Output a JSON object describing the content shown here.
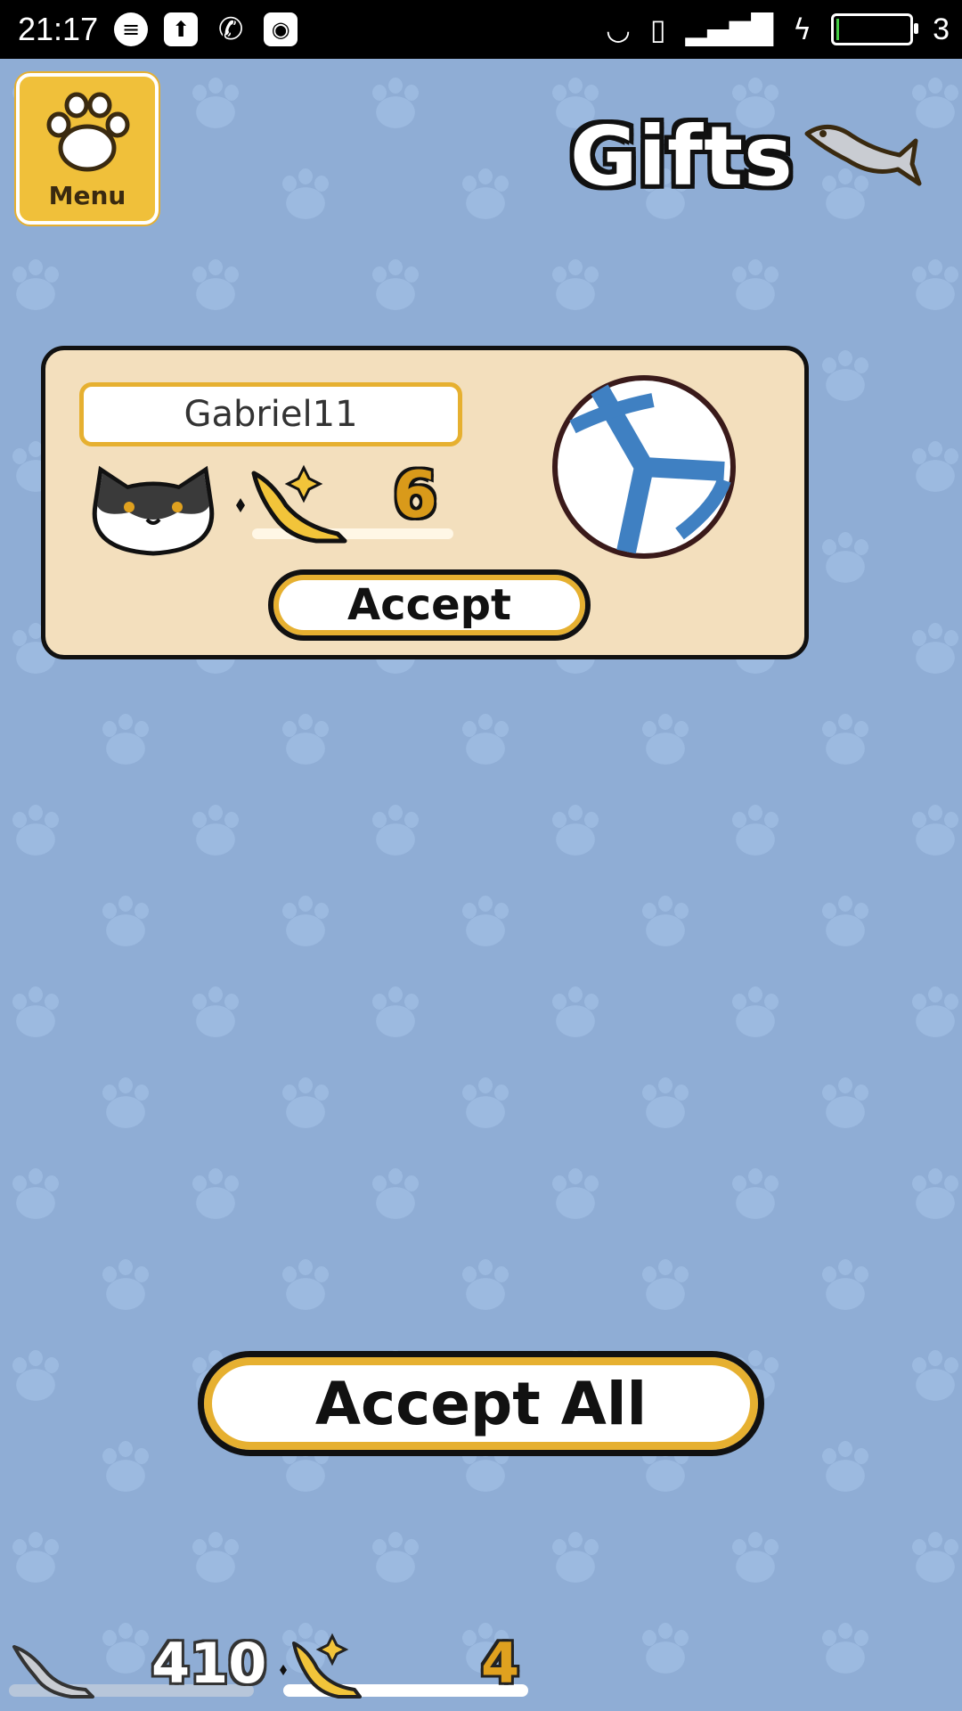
{
  "status_bar": {
    "time": "21:17",
    "battery_level": "3",
    "colors": {
      "background": "#000000",
      "text": "#ffffff"
    },
    "left_icons": [
      "chat-bubble-icon",
      "upload-icon",
      "phone-icon",
      "qq-penguin-icon"
    ],
    "right_icons": [
      "headset-icon",
      "vibrate-icon",
      "signal-icon",
      "charging-icon",
      "battery-icon"
    ]
  },
  "menu": {
    "label": "Menu",
    "icon": "paw-icon"
  },
  "header": {
    "title": "Gifts",
    "icon": "silver-fish-icon"
  },
  "gift": {
    "sender": "Gabriel11",
    "cat_icon": "black-white-cat-icon",
    "currency_icon": "gold-fish-icon",
    "amount": "6",
    "item_icon": "blue-ball-icon",
    "accept_label": "Accept"
  },
  "accept_all_label": "Accept All",
  "currency": {
    "silver": "410",
    "gold": "4"
  },
  "colors": {
    "background": "#8fadd5",
    "card": "#f3dfbd",
    "accent": "#e6b030",
    "gold_text": "#d99a1a"
  }
}
